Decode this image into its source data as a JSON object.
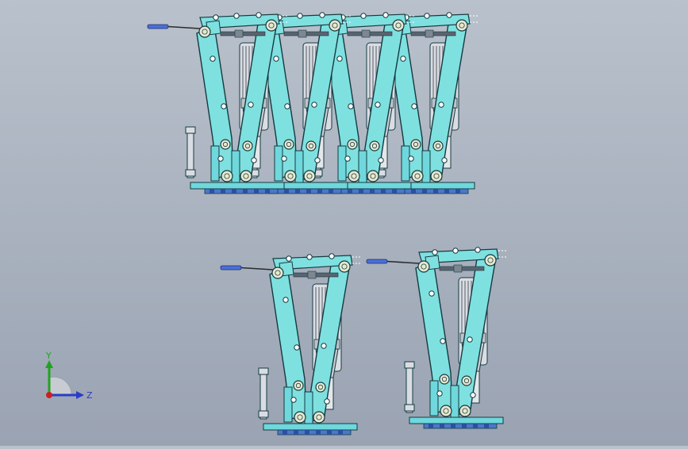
{
  "viewport": {
    "background_top": "#b9c1cc",
    "background_bottom": "#9aa3b2"
  },
  "colors": {
    "arm_fill": "#7fe0e0",
    "arm_stroke": "#153a40",
    "base_fill": "#6fd8dc",
    "shoe_fill": "#4a78c8",
    "motor_fill": "#d9dde3",
    "motor_dark": "#7c8088",
    "pin_fill": "#e8e8d0",
    "rod_fill": "#4b6fd6"
  },
  "assemblies": {
    "top_count": 4,
    "bottom_count": 2
  },
  "triad": {
    "y_label": "Y",
    "z_label": "Z",
    "y_color": "#21a321",
    "z_color": "#2a3cc7",
    "x_color": "#cc2020"
  }
}
